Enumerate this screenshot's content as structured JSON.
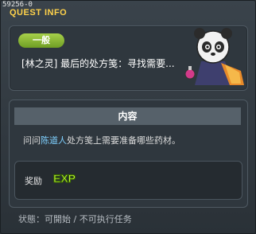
{
  "window": {
    "id_label": "59256-0",
    "title": "QUEST INFO"
  },
  "quest": {
    "category": "一般",
    "title": "[林之灵] 最后的处方笺：寻找需要..."
  },
  "content": {
    "header": "内容",
    "desc_prefix": "问问",
    "desc_npc": "陈道人",
    "desc_suffix": "处方笺上需要准备哪些药材。"
  },
  "reward": {
    "label": "奖励",
    "type": "EXP"
  },
  "status": "状態：可開始 / 不可执行任务",
  "colors": {
    "title": "#ffd24a",
    "category_bg": "#8dbb36",
    "npc_name": "#7fd0ff",
    "exp": "#c8ff3a"
  }
}
